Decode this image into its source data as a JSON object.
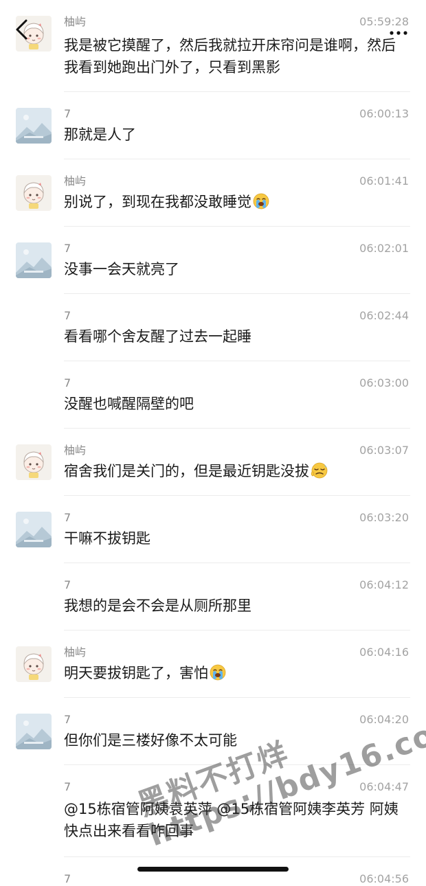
{
  "messages": [
    {
      "name": "柚屿",
      "time": "05:59:28",
      "avatar": "girl",
      "text": "我是被它摸醒了，然后我就拉开床帘问是谁啊，然后我看到她跑出门外了，只看到黑影"
    },
    {
      "name": "7",
      "time": "06:00:13",
      "avatar": "landscape",
      "text": "那就是人了"
    },
    {
      "name": "柚屿",
      "time": "06:01:41",
      "avatar": "girl",
      "text": "别说了，到现在我都没敢睡觉",
      "emoji": "crying-face"
    },
    {
      "name": "7",
      "time": "06:02:01",
      "avatar": "landscape",
      "text": "没事一会天就亮了"
    },
    {
      "name": "7",
      "time": "06:02:44",
      "avatar": "",
      "text": "看看哪个舍友醒了过去一起睡"
    },
    {
      "name": "7",
      "time": "06:03:00",
      "avatar": "",
      "text": "没醒也喊醒隔壁的吧"
    },
    {
      "name": "柚屿",
      "time": "06:03:07",
      "avatar": "girl",
      "text": "宿舍我们是关门的，但是最近钥匙没拔",
      "emoji": "sad-tired-face"
    },
    {
      "name": "7",
      "time": "06:03:20",
      "avatar": "landscape",
      "text": "干嘛不拔钥匙"
    },
    {
      "name": "7",
      "time": "06:04:12",
      "avatar": "",
      "text": "我想的是会不会是从厕所那里"
    },
    {
      "name": "柚屿",
      "time": "06:04:16",
      "avatar": "girl",
      "text": "明天要拔钥匙了，害怕",
      "emoji": "crying-face"
    },
    {
      "name": "7",
      "time": "06:04:20",
      "avatar": "landscape",
      "text": "但你们是三楼好像不太可能"
    },
    {
      "name": "7",
      "time": "06:04:47",
      "avatar": "",
      "text": "@15栋宿管阿姨袁英萍 @15栋宿管阿姨李英芳 阿姨快点出来看看咋回事"
    },
    {
      "name": "7",
      "time": "06:04:56",
      "avatar": "",
      "text": ""
    }
  ],
  "watermark": {
    "line1": "黑料不打烊",
    "line2": "https://bdy16.co"
  },
  "icons": {
    "back": "back-chevron-icon",
    "more": "more-dots-icon"
  },
  "colors": {
    "name": "#8a8a8a",
    "time": "#a3a3a3",
    "text": "#1b1b1b",
    "separator": "#ececec"
  }
}
